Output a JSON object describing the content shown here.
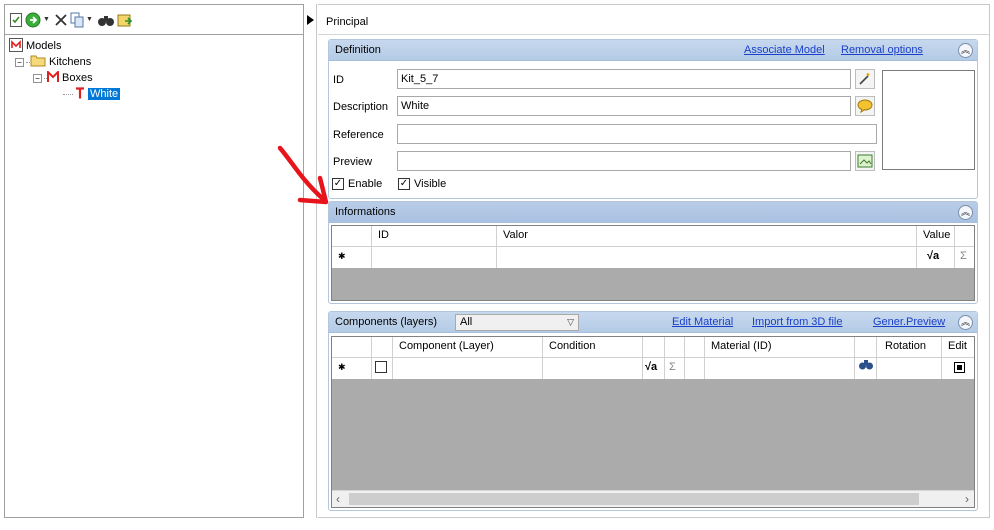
{
  "toolbar": {
    "icons": [
      "new-doc-icon",
      "go-icon",
      "delete-icon",
      "copy-icon",
      "find-icon",
      "export-icon"
    ]
  },
  "tree": {
    "root": "Models",
    "child": "Kitchens",
    "grandchild": "Boxes",
    "selected": "White"
  },
  "principal_tab": "Principal",
  "definition": {
    "title": "Definition",
    "associate_model": "Associate Model",
    "removal_options": "Removal options",
    "id_label": "ID",
    "id_value": "Kit_5_7",
    "description_label": "Description",
    "description_value": "White",
    "reference_label": "Reference",
    "reference_value": "",
    "preview_label": "Preview",
    "preview_value": "",
    "enable_label": "Enable",
    "enable_checked": true,
    "visible_label": "Visible",
    "visible_checked": true
  },
  "informations": {
    "title": "Informations",
    "columns": [
      "ID",
      "Valor",
      "Value"
    ]
  },
  "components": {
    "title": "Components (layers)",
    "filter_value": "All",
    "edit_material": "Edit Material",
    "import_3d": "Import from 3D file",
    "gener_preview": "Gener.Preview",
    "columns": [
      "Component (Layer)",
      "Condition",
      "Material (ID)",
      "Rotation",
      "Edit"
    ]
  },
  "colors": {
    "header_bg": "#c6d8ee",
    "link": "#1a3fc8",
    "selection": "#0078d7",
    "grid_empty": "#ababab",
    "arrow": "#e8141c"
  }
}
